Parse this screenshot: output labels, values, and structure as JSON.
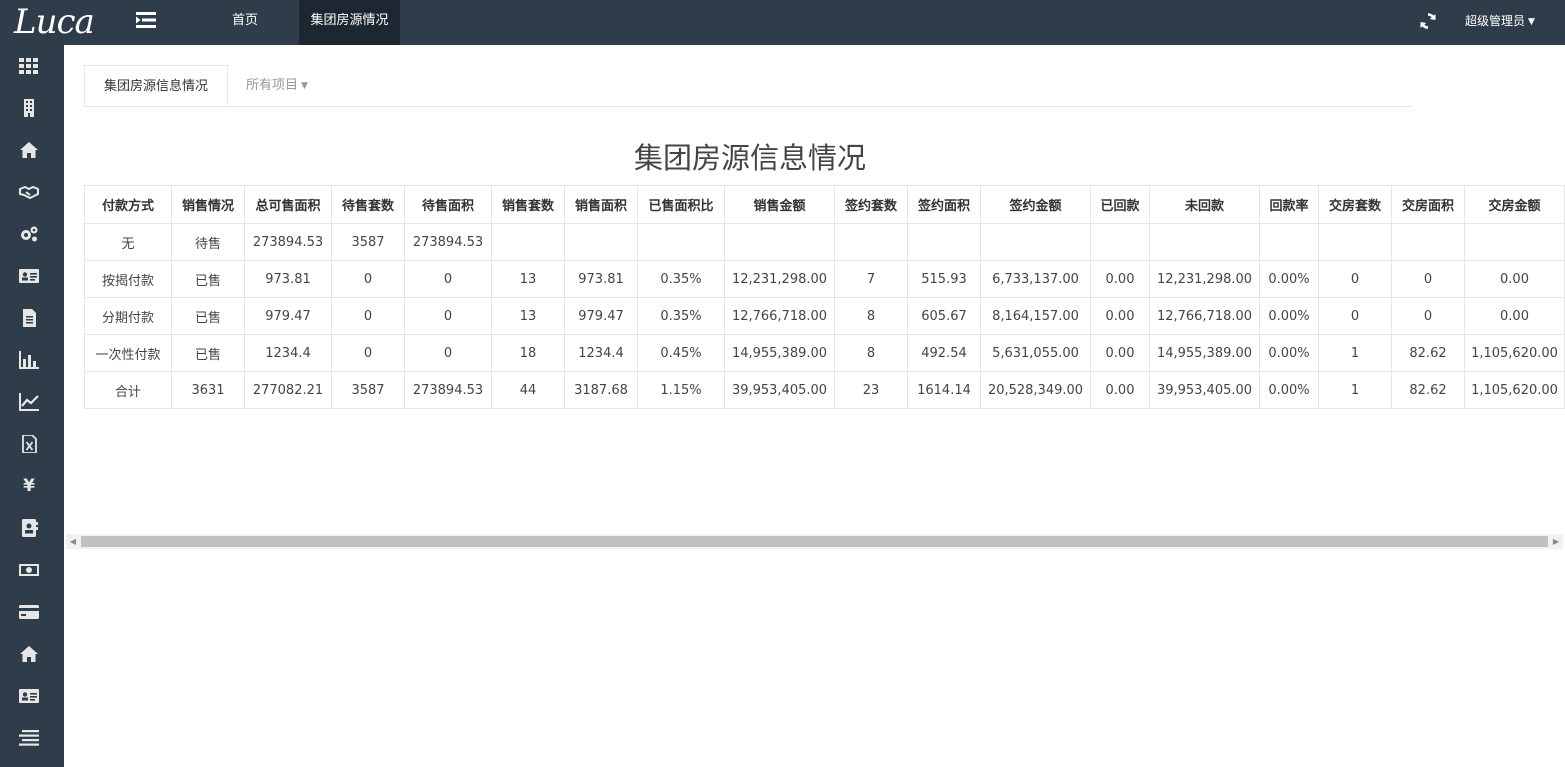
{
  "app": {
    "logo": "Luca"
  },
  "topbar": {
    "nav": [
      {
        "label": "首页"
      },
      {
        "label": "集团房源情况"
      }
    ],
    "user": "超级管理员"
  },
  "sidebar": {
    "icons": [
      "grid-icon",
      "building-icon",
      "home-icon",
      "handshake-icon",
      "gears-icon",
      "id-card-icon",
      "document-icon",
      "bar-chart-icon",
      "line-chart-icon",
      "excel-file-icon",
      "yen-icon",
      "contacts-icon",
      "money-icon",
      "credit-card-icon",
      "home-icon",
      "id-card-icon",
      "list-icon"
    ],
    "yen_symbol": "¥"
  },
  "tabs": {
    "active": "集团房源信息情况",
    "dropdown": "所有项目"
  },
  "report": {
    "title": "集团房源信息情况",
    "headers": [
      "付款方式",
      "销售情况",
      "总可售面积",
      "待售套数",
      "待售面积",
      "销售套数",
      "销售面积",
      "已售面积比",
      "销售金额",
      "签约套数",
      "签约面积",
      "签约金额",
      "已回款",
      "未回款",
      "回款率",
      "交房套数",
      "交房面积",
      "交房金额"
    ],
    "rows": [
      [
        "无",
        "待售",
        "273894.53",
        "3587",
        "273894.53",
        "",
        "",
        "",
        "",
        "",
        "",
        "",
        "",
        "",
        "",
        "",
        "",
        ""
      ],
      [
        "按揭付款",
        "已售",
        "973.81",
        "0",
        "0",
        "13",
        "973.81",
        "0.35%",
        "12,231,298.00",
        "7",
        "515.93",
        "6,733,137.00",
        "0.00",
        "12,231,298.00",
        "0.00%",
        "0",
        "0",
        "0.00"
      ],
      [
        "分期付款",
        "已售",
        "979.47",
        "0",
        "0",
        "13",
        "979.47",
        "0.35%",
        "12,766,718.00",
        "8",
        "605.67",
        "8,164,157.00",
        "0.00",
        "12,766,718.00",
        "0.00%",
        "0",
        "0",
        "0.00"
      ],
      [
        "一次性付款",
        "已售",
        "1234.4",
        "0",
        "0",
        "18",
        "1234.4",
        "0.45%",
        "14,955,389.00",
        "8",
        "492.54",
        "5,631,055.00",
        "0.00",
        "14,955,389.00",
        "0.00%",
        "1",
        "82.62",
        "1,105,620.00"
      ],
      [
        "合计",
        "3631",
        "277082.21",
        "3587",
        "273894.53",
        "44",
        "3187.68",
        "1.15%",
        "39,953,405.00",
        "23",
        "1614.14",
        "20,528,349.00",
        "0.00",
        "39,953,405.00",
        "0.00%",
        "1",
        "82.62",
        "1,105,620.00"
      ]
    ]
  }
}
